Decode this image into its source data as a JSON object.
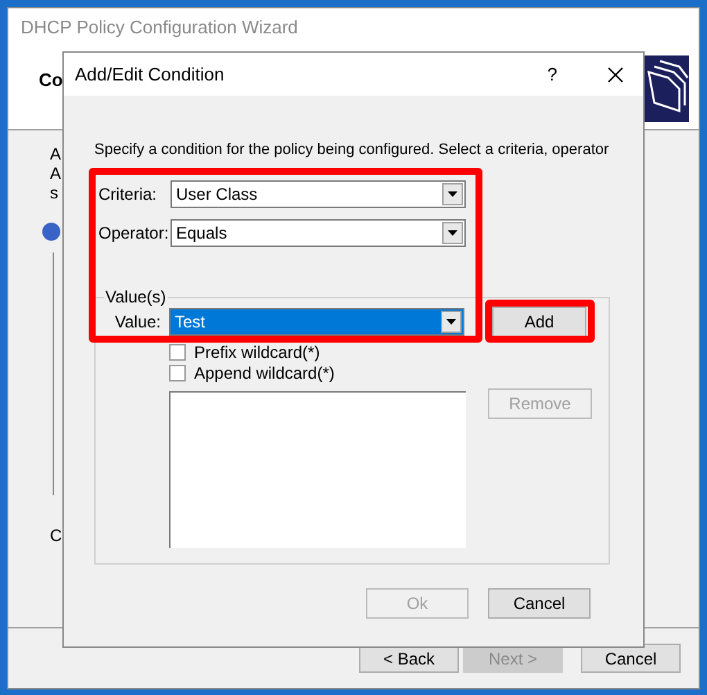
{
  "wizard": {
    "title": "DHCP Policy Configuration Wizard",
    "heading": "Co",
    "fragments": [
      "A",
      "A",
      "s"
    ],
    "lower_fragment": "C",
    "buttons": [
      {
        "label": "< Back",
        "disabled": false
      },
      {
        "label": "Next >",
        "disabled": true
      },
      {
        "label": "Cancel",
        "disabled": false
      }
    ]
  },
  "dialog": {
    "title": "Add/Edit Condition",
    "help": "?",
    "intro": "Specify a condition for the policy being configured. Select a criteria, operator",
    "fields": [
      {
        "label": "Criteria:",
        "value": "User Class"
      },
      {
        "label": "Operator:",
        "value": "Equals"
      }
    ],
    "group": {
      "title": "Value(s)",
      "value_label": "Value:",
      "value": "Test",
      "add": "Add",
      "remove": {
        "label": "Remove",
        "disabled": true
      },
      "checkboxes": [
        {
          "label": "Prefix wildcard(*)",
          "checked": false
        },
        {
          "label": "Append wildcard(*)",
          "checked": false
        }
      ]
    },
    "buttons": [
      {
        "label": "Ok",
        "disabled": true
      },
      {
        "label": "Cancel",
        "disabled": false
      }
    ]
  }
}
